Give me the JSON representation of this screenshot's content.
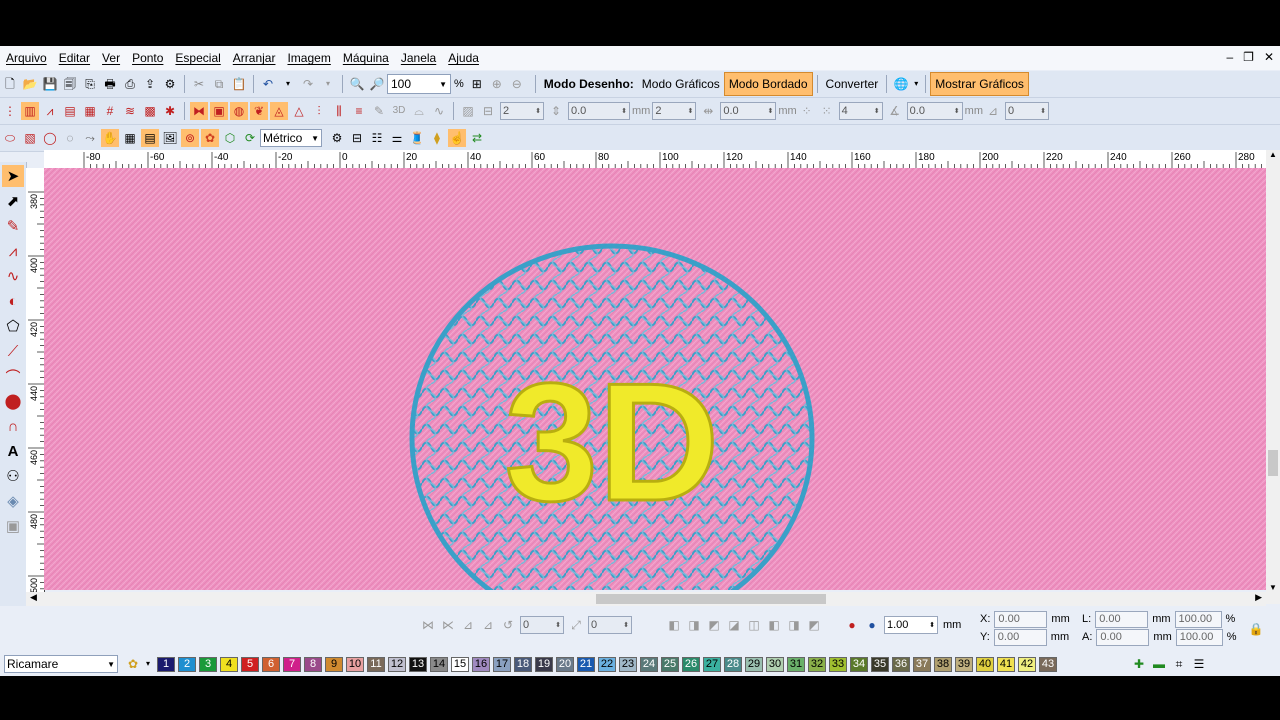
{
  "menu": [
    "Arquivo",
    "Editar",
    "Ver",
    "Ponto",
    "Especial",
    "Arranjar",
    "Imagem",
    "Máquina",
    "Janela",
    "Ajuda"
  ],
  "window_controls": [
    "–",
    "❐",
    "✕"
  ],
  "toolbar1": {
    "zoom_value": "100",
    "zoom_unit": "%",
    "mode_label": "Modo Desenho:",
    "btn_graphics": "Modo Gráficos",
    "btn_embroidery": "Modo Bordado",
    "btn_convert": "Converter",
    "btn_show_graphics": "Mostrar Gráficos"
  },
  "toolbar2": {
    "fields": [
      {
        "value": "2",
        "unit": ""
      },
      {
        "value": "0.0",
        "unit": "mm"
      },
      {
        "value": "2",
        "unit": ""
      },
      {
        "value": "0.0",
        "unit": "mm"
      },
      {
        "value": "4",
        "unit": ""
      },
      {
        "value": "0.0",
        "unit": "mm"
      },
      {
        "value": "0",
        "unit": ""
      }
    ],
    "stitch_3d_label": "3D"
  },
  "toolbar3": {
    "units_value": "Métrico"
  },
  "ruler_top": [
    "-80",
    "-60",
    "-40",
    "-20",
    "0",
    "20",
    "40",
    "60",
    "80",
    "100",
    "120",
    "140",
    "160",
    "180",
    "200",
    "220",
    "240",
    "260",
    "280"
  ],
  "ruler_left": [
    "380",
    "400",
    "420",
    "440",
    "460",
    "480",
    "500"
  ],
  "design": {
    "text": "3D",
    "fabric_color": "#ee8fbf",
    "sphere_color": "#3aa0c8",
    "text_color": "#f0ea2a"
  },
  "bottom_toolbar": {
    "rotate_value": "0",
    "slant_value": "0",
    "scale_value": "1.00",
    "scale_unit": "mm",
    "x_label": "X:",
    "x_value": "0.00",
    "x_unit": "mm",
    "y_label": "Y:",
    "y_value": "0.00",
    "y_unit": "mm",
    "l_label": "L:",
    "l_value": "0.00",
    "l_unit": "mm",
    "l_pct": "100.00",
    "l_pct_sign": "%",
    "a_label": "A:",
    "a_value": "0.00",
    "a_unit": "mm",
    "a_pct": "100.00",
    "a_pct_sign": "%"
  },
  "palette_selector": "Ricamare",
  "palette": [
    {
      "n": "1",
      "c": "#1a1a6e",
      "t": "#fff"
    },
    {
      "n": "2",
      "c": "#1e8fd0",
      "t": "#fff"
    },
    {
      "n": "3",
      "c": "#1a9a3a",
      "t": "#fff"
    },
    {
      "n": "4",
      "c": "#f0e020",
      "t": "#000"
    },
    {
      "n": "5",
      "c": "#d02020",
      "t": "#fff"
    },
    {
      "n": "6",
      "c": "#d06030",
      "t": "#fff"
    },
    {
      "n": "7",
      "c": "#d0208a",
      "t": "#fff"
    },
    {
      "n": "8",
      "c": "#9a4a8a",
      "t": "#fff"
    },
    {
      "n": "9",
      "c": "#d08a30",
      "t": "#000"
    },
    {
      "n": "10",
      "c": "#e8a0a0",
      "t": "#000"
    },
    {
      "n": "11",
      "c": "#7a6a5a",
      "t": "#fff"
    },
    {
      "n": "12",
      "c": "#c0c0d0",
      "t": "#000"
    },
    {
      "n": "13",
      "c": "#111111",
      "t": "#fff"
    },
    {
      "n": "14",
      "c": "#8a8a8a",
      "t": "#000"
    },
    {
      "n": "15",
      "c": "#ffffff",
      "t": "#000"
    },
    {
      "n": "16",
      "c": "#a08ac0",
      "t": "#000"
    },
    {
      "n": "17",
      "c": "#8aa0c0",
      "t": "#000"
    },
    {
      "n": "18",
      "c": "#4a5a7a",
      "t": "#fff"
    },
    {
      "n": "19",
      "c": "#3a3a4a",
      "t": "#fff"
    },
    {
      "n": "20",
      "c": "#6a7a8a",
      "t": "#fff"
    },
    {
      "n": "21",
      "c": "#1a5ab0",
      "t": "#fff"
    },
    {
      "n": "22",
      "c": "#6ab0e0",
      "t": "#000"
    },
    {
      "n": "23",
      "c": "#a0b8c8",
      "t": "#000"
    },
    {
      "n": "24",
      "c": "#5a7a7a",
      "t": "#fff"
    },
    {
      "n": "25",
      "c": "#4a7a6a",
      "t": "#fff"
    },
    {
      "n": "26",
      "c": "#2a8a6a",
      "t": "#fff"
    },
    {
      "n": "27",
      "c": "#3ab0a0",
      "t": "#000"
    },
    {
      "n": "28",
      "c": "#4a8a8a",
      "t": "#fff"
    },
    {
      "n": "29",
      "c": "#9ac0b0",
      "t": "#000"
    },
    {
      "n": "30",
      "c": "#b0d0b0",
      "t": "#000"
    },
    {
      "n": "31",
      "c": "#6ab06a",
      "t": "#000"
    },
    {
      "n": "32",
      "c": "#8ab04a",
      "t": "#000"
    },
    {
      "n": "33",
      "c": "#a0c030",
      "t": "#000"
    },
    {
      "n": "34",
      "c": "#5a7a2a",
      "t": "#fff"
    },
    {
      "n": "35",
      "c": "#3a3a2a",
      "t": "#fff"
    },
    {
      "n": "36",
      "c": "#6a6a4a",
      "t": "#fff"
    },
    {
      "n": "37",
      "c": "#8a7a5a",
      "t": "#fff"
    },
    {
      "n": "38",
      "c": "#b0a070",
      "t": "#000"
    },
    {
      "n": "39",
      "c": "#c0b080",
      "t": "#000"
    },
    {
      "n": "40",
      "c": "#e0d040",
      "t": "#000"
    },
    {
      "n": "41",
      "c": "#f0e050",
      "t": "#000"
    },
    {
      "n": "42",
      "c": "#f0f080",
      "t": "#000"
    },
    {
      "n": "43",
      "c": "#7a6a5a",
      "t": "#fff"
    }
  ]
}
